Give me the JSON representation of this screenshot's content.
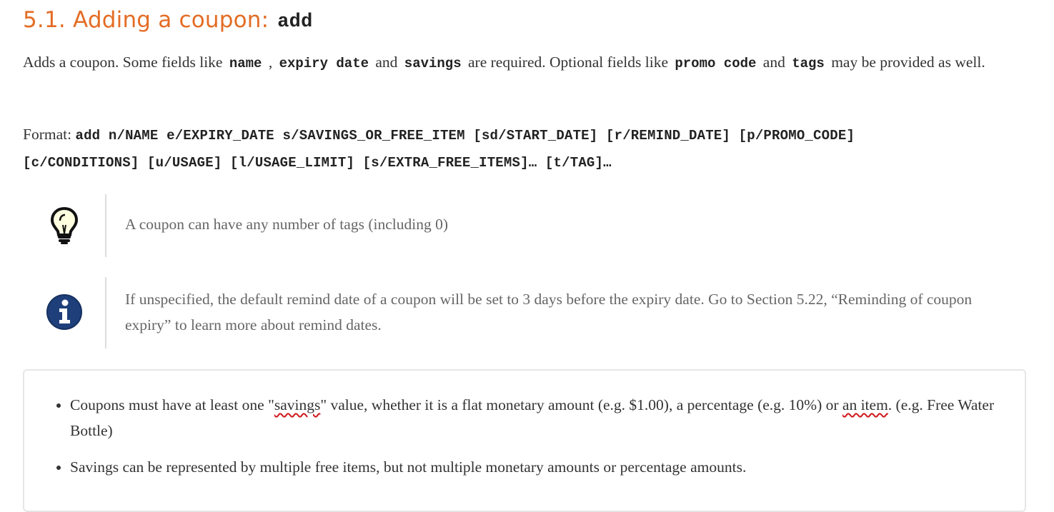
{
  "section": {
    "title": "5.1. Adding a coupon:",
    "command": "add"
  },
  "intro": {
    "t1": "Adds a coupon. Some fields like ",
    "c1": "name",
    "t2": " , ",
    "c2": "expiry date",
    "t3": " and ",
    "c3": "savings",
    "t4": " are required. Optional fields like ",
    "c4": "promo code",
    "t5": " and ",
    "c5": "tags",
    "t6": " may be provided as well."
  },
  "format": {
    "label": "Format:",
    "syntax": "add n/NAME e/EXPIRY_DATE s/SAVINGS_OR_FREE_ITEM [sd/START_DATE] [r/REMIND_DATE] [p/PROMO_CODE] [c/CONDITIONS] [u/USAGE] [l/USAGE_LIMIT] [s/EXTRA_FREE_ITEMS]… [t/TAG]…"
  },
  "tip": {
    "icon": "lightbulb-icon",
    "text": "A coupon can have any number of tags (including 0)"
  },
  "note": {
    "icon": "info-icon",
    "text": "If unspecified, the default remind date of a coupon will be set to 3 days before the expiry date. Go to Section 5.22, “Reminding of coupon expiry” to learn more about remind dates."
  },
  "rules": {
    "item1": {
      "t1": "Coupons must have at least one \"",
      "w1": "savings",
      "t2": "\" value, whether it is a flat monetary amount (e.g. $1.00), a percentage (e.g. 10%) or ",
      "w2": "an item",
      "t3": ". (e.g. Free Water Bottle)"
    },
    "item2": "Savings can be represented by multiple free items, but not multiple monetary amounts or percentage amounts."
  },
  "colors": {
    "heading": "#e46c25",
    "info_icon": "#1f3f7a",
    "spellcheck": "#d0181c"
  }
}
